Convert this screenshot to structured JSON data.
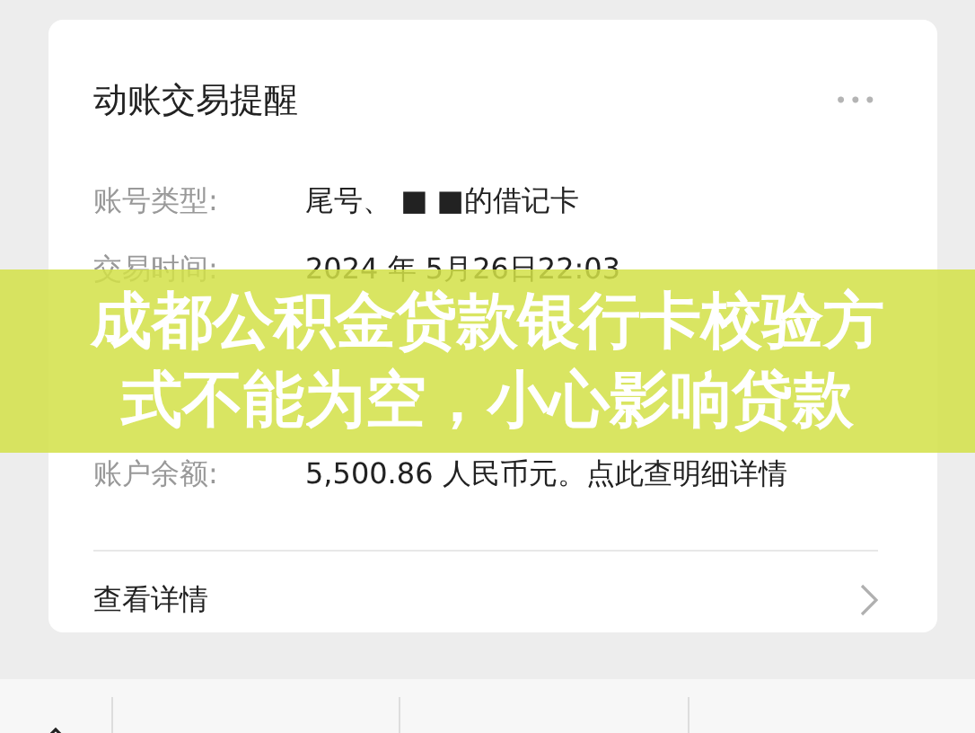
{
  "card": {
    "title": "动账交易提醒",
    "more_icon": "•••",
    "rows": [
      {
        "label": "账号类型:",
        "value": "尾号、 ■ ■的借记卡"
      },
      {
        "label": "交易时间:",
        "value": "2024 年 5月26日22:03"
      },
      {
        "label": "账户余额:",
        "value": "5,500.86 人民币元。点此查明细详情"
      }
    ],
    "link": "查看详情"
  },
  "banner": {
    "text": "成都公积金贷款银行卡校验方式不能为空，小心影响贷款"
  }
}
